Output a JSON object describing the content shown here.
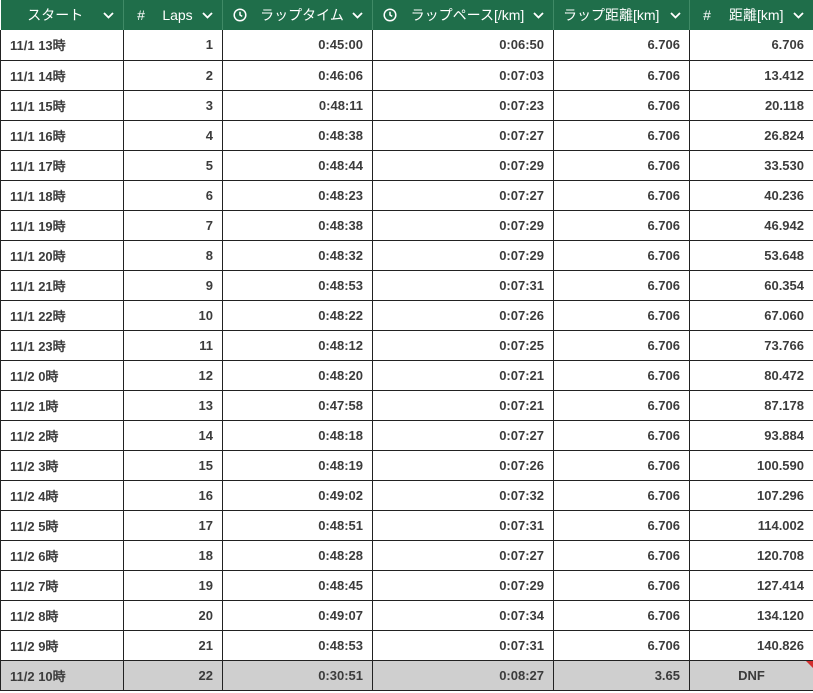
{
  "headers": [
    {
      "icon": "",
      "label": "スタート"
    },
    {
      "icon": "#",
      "label": "Laps"
    },
    {
      "icon": "clock-icon",
      "label": "ラップタイム"
    },
    {
      "icon": "clock-icon",
      "label": "ラップペース[/km]"
    },
    {
      "icon": "",
      "label": "ラップ距離[km]"
    },
    {
      "icon": "#",
      "label": "距離[km]"
    }
  ],
  "rows": [
    [
      "11/1 13時",
      "1",
      "0:45:00",
      "0:06:50",
      "6.706",
      "6.706"
    ],
    [
      "11/1 14時",
      "2",
      "0:46:06",
      "0:07:03",
      "6.706",
      "13.412"
    ],
    [
      "11/1 15時",
      "3",
      "0:48:11",
      "0:07:23",
      "6.706",
      "20.118"
    ],
    [
      "11/1 16時",
      "4",
      "0:48:38",
      "0:07:27",
      "6.706",
      "26.824"
    ],
    [
      "11/1 17時",
      "5",
      "0:48:44",
      "0:07:29",
      "6.706",
      "33.530"
    ],
    [
      "11/1 18時",
      "6",
      "0:48:23",
      "0:07:27",
      "6.706",
      "40.236"
    ],
    [
      "11/1 19時",
      "7",
      "0:48:38",
      "0:07:29",
      "6.706",
      "46.942"
    ],
    [
      "11/1 20時",
      "8",
      "0:48:32",
      "0:07:29",
      "6.706",
      "53.648"
    ],
    [
      "11/1 21時",
      "9",
      "0:48:53",
      "0:07:31",
      "6.706",
      "60.354"
    ],
    [
      "11/1 22時",
      "10",
      "0:48:22",
      "0:07:26",
      "6.706",
      "67.060"
    ],
    [
      "11/1 23時",
      "11",
      "0:48:12",
      "0:07:25",
      "6.706",
      "73.766"
    ],
    [
      "11/2 0時",
      "12",
      "0:48:20",
      "0:07:21",
      "6.706",
      "80.472"
    ],
    [
      "11/2 1時",
      "13",
      "0:47:58",
      "0:07:21",
      "6.706",
      "87.178"
    ],
    [
      "11/2 2時",
      "14",
      "0:48:18",
      "0:07:27",
      "6.706",
      "93.884"
    ],
    [
      "11/2 3時",
      "15",
      "0:48:19",
      "0:07:26",
      "6.706",
      "100.590"
    ],
    [
      "11/2 4時",
      "16",
      "0:49:02",
      "0:07:32",
      "6.706",
      "107.296"
    ],
    [
      "11/2 5時",
      "17",
      "0:48:51",
      "0:07:31",
      "6.706",
      "114.002"
    ],
    [
      "11/2 6時",
      "18",
      "0:48:28",
      "0:07:27",
      "6.706",
      "120.708"
    ],
    [
      "11/2 7時",
      "19",
      "0:48:45",
      "0:07:29",
      "6.706",
      "127.414"
    ],
    [
      "11/2 8時",
      "20",
      "0:49:07",
      "0:07:34",
      "6.706",
      "134.120"
    ],
    [
      "11/2 9時",
      "21",
      "0:48:53",
      "0:07:31",
      "6.706",
      "140.826"
    ]
  ],
  "final_row": [
    "11/2 10時",
    "22",
    "0:30:51",
    "0:08:27",
    "3.65",
    "DNF"
  ],
  "colors": {
    "header_bg": "#1f6e4a",
    "final_row_bg": "#cfcfcf",
    "comment_flag": "#d32f2f"
  }
}
